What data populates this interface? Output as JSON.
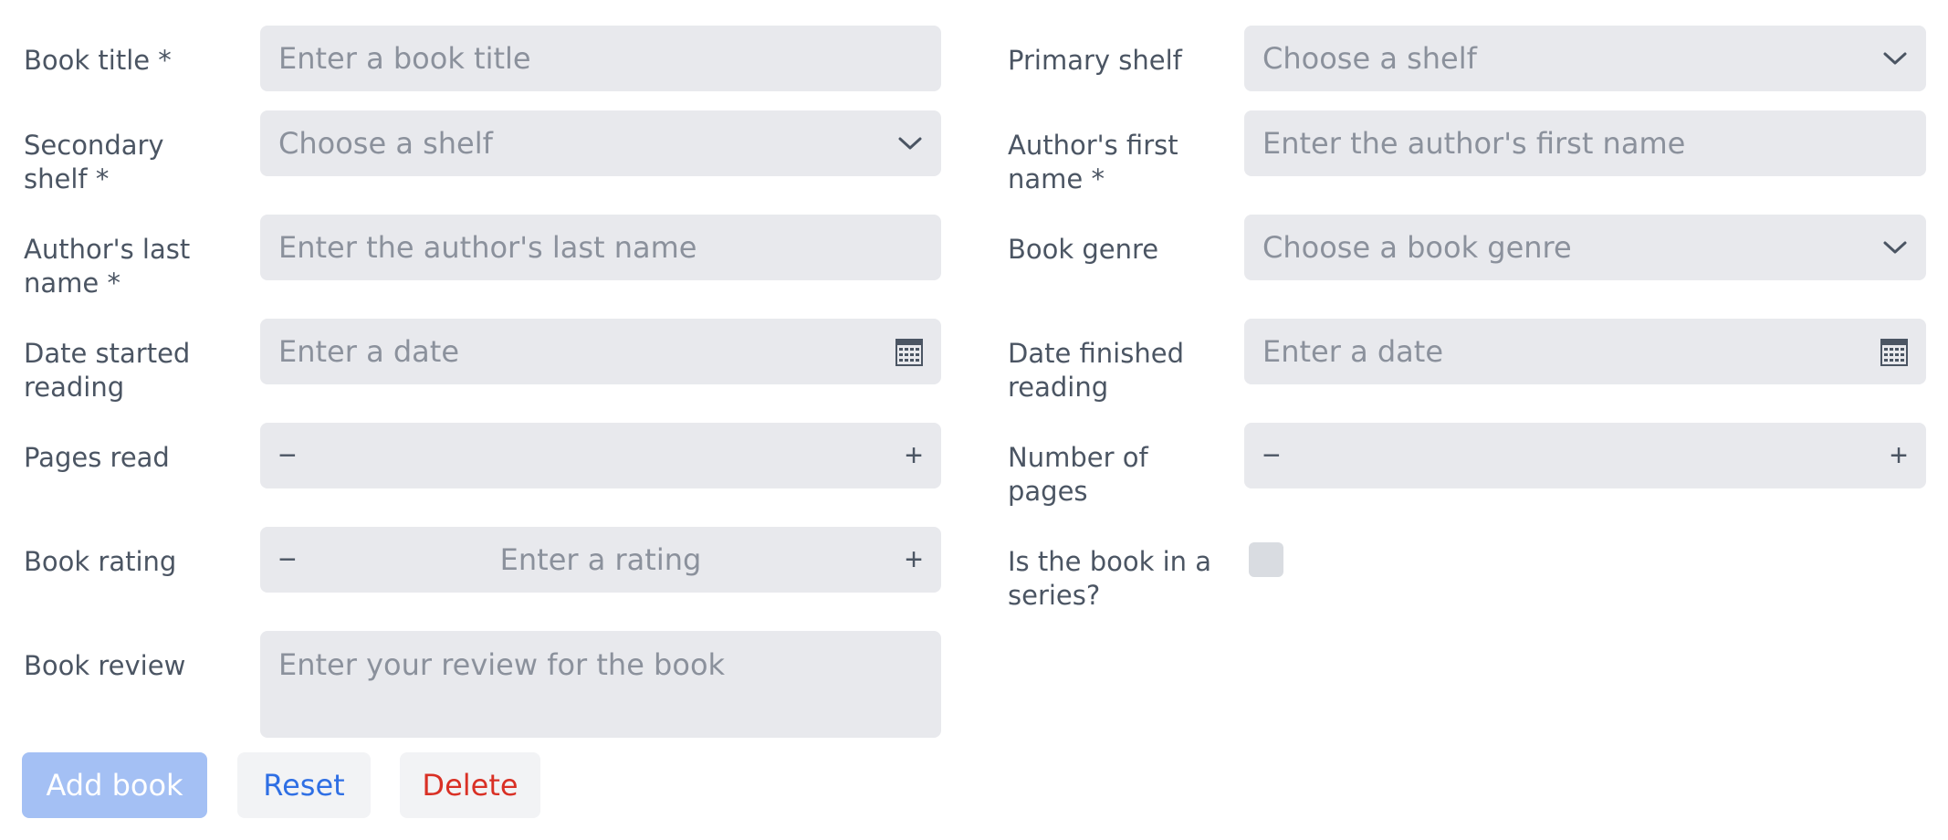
{
  "form": {
    "left": {
      "book_title": {
        "label": "Book title *",
        "placeholder": "Enter a book title"
      },
      "secondary_shelf": {
        "label": "Secondary shelf *",
        "placeholder": "Choose a shelf"
      },
      "author_last": {
        "label": "Author's last name *",
        "placeholder": "Enter the author's last name"
      },
      "date_started": {
        "label": "Date started reading",
        "placeholder": "Enter a date"
      },
      "pages_read": {
        "label": "Pages read",
        "minus": "−",
        "plus": "+"
      },
      "rating": {
        "label": "Book rating",
        "placeholder": "Enter a rating",
        "minus": "−",
        "plus": "+"
      },
      "review": {
        "label": "Book review",
        "placeholder": "Enter your review for the book"
      }
    },
    "right": {
      "primary_shelf": {
        "label": "Primary shelf",
        "placeholder": "Choose a shelf"
      },
      "author_first": {
        "label": "Author's first name *",
        "placeholder": "Enter the author's first name"
      },
      "genre": {
        "label": "Book genre",
        "placeholder": "Choose a book genre"
      },
      "date_finished": {
        "label": "Date finished reading",
        "placeholder": "Enter a date"
      },
      "num_pages": {
        "label": "Number of pages",
        "minus": "−",
        "plus": "+"
      },
      "series": {
        "label": "Is the book in a series?"
      }
    }
  },
  "actions": {
    "add": "Add book",
    "reset": "Reset",
    "delete": "Delete"
  },
  "icons": {
    "dropdown": "chevron-down-icon",
    "calendar": "calendar-icon"
  },
  "colors": {
    "field_bg": "#e8e9ed",
    "add_bg": "#a4c0f4",
    "reset_text": "#2f6fe4",
    "delete_text": "#d93025"
  }
}
